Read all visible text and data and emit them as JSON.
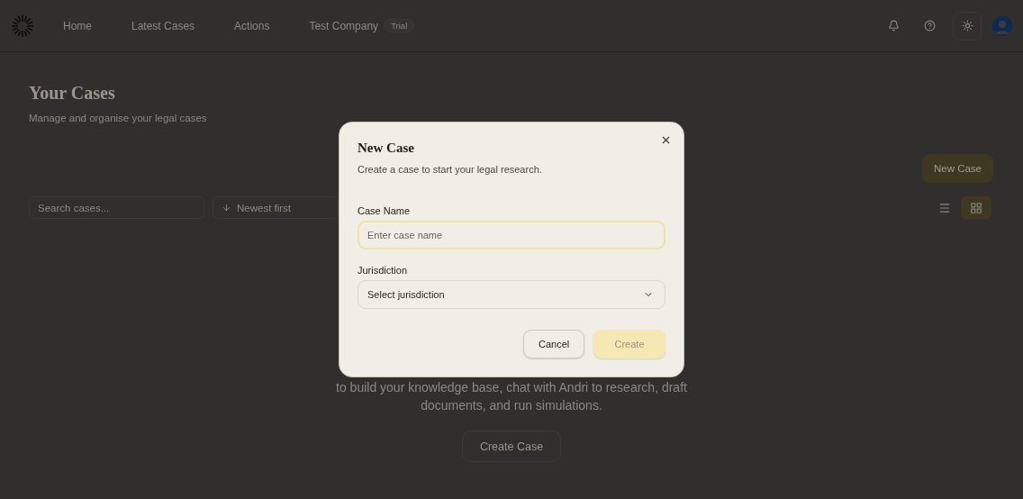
{
  "nav": {
    "items": [
      {
        "label": "Home"
      },
      {
        "label": "Latest Cases"
      },
      {
        "label": "Actions"
      }
    ],
    "company": {
      "name": "Test Company",
      "badge": "Trial"
    }
  },
  "page": {
    "title": "Your Cases",
    "subtitle": "Manage and organise your legal cases",
    "new_button": "New Case"
  },
  "toolbar": {
    "search": {
      "placeholder": "Search cases..."
    },
    "sort": {
      "value": "Newest first"
    },
    "view_modes": [
      {
        "kind": "list",
        "selected": false
      },
      {
        "kind": "grid",
        "selected": true
      }
    ]
  },
  "empty_state": {
    "lines": [
      "to build your knowledge base, chat with Andri to research, draft",
      "documents, and run simulations."
    ],
    "button": "Create Case"
  },
  "dialog": {
    "title": "New Case",
    "description": "Create a case to start your legal research.",
    "fields": [
      {
        "kind": "text",
        "label": "Case Name",
        "placeholder": "Enter case name",
        "focused": true
      },
      {
        "kind": "select",
        "label": "Jurisdiction",
        "placeholder": "Select jurisdiction",
        "focused": false
      }
    ],
    "buttons": [
      {
        "kind": "secondary",
        "label": "Cancel",
        "disabled": false
      },
      {
        "kind": "primary",
        "label": "Create",
        "disabled": true
      }
    ]
  }
}
